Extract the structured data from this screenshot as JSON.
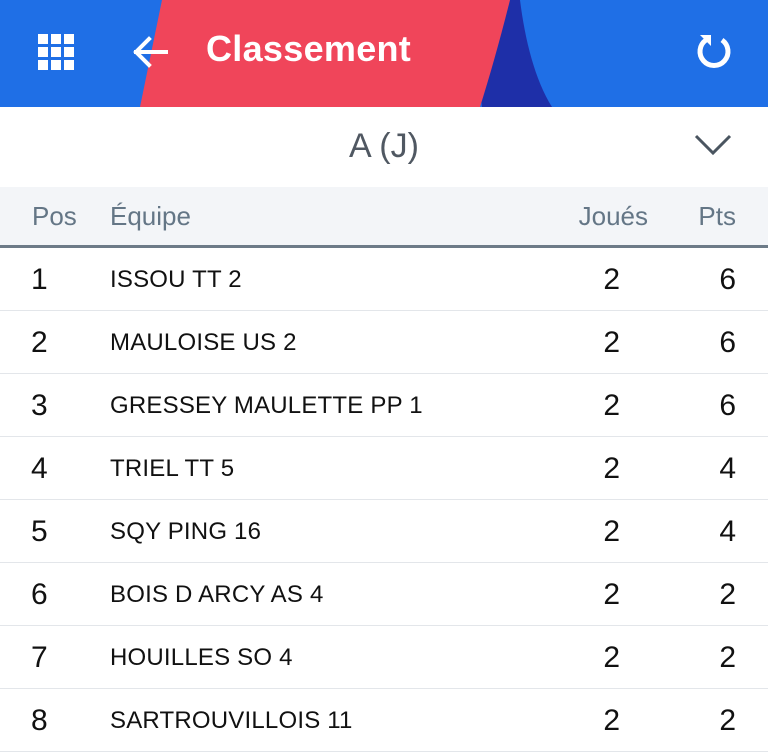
{
  "header": {
    "title": "Classement",
    "apps_icon": "grid-icon",
    "back_icon": "arrow-left-icon",
    "refresh_icon": "refresh-icon",
    "colors": {
      "blue": "#1f6fe6",
      "red": "#f0455a",
      "navy": "#1e2fa8"
    }
  },
  "group_selector": {
    "value": "A (J)",
    "icon": "chevron-down-icon"
  },
  "table": {
    "headers": {
      "pos": "Pos",
      "team": "Équipe",
      "played": "Joués",
      "points": "Pts"
    },
    "rows": [
      {
        "pos": "1",
        "team": "ISSOU TT 2",
        "played": "2",
        "points": "6"
      },
      {
        "pos": "2",
        "team": "MAULOISE US 2",
        "played": "2",
        "points": "6"
      },
      {
        "pos": "3",
        "team": "GRESSEY MAULETTE PP 1",
        "played": "2",
        "points": "6"
      },
      {
        "pos": "4",
        "team": "TRIEL TT 5",
        "played": "2",
        "points": "4"
      },
      {
        "pos": "5",
        "team": "SQY PING 16",
        "played": "2",
        "points": "4"
      },
      {
        "pos": "6",
        "team": "BOIS D ARCY AS 4",
        "played": "2",
        "points": "2"
      },
      {
        "pos": "7",
        "team": "HOUILLES SO 4",
        "played": "2",
        "points": "2"
      },
      {
        "pos": "8",
        "team": "SARTROUVILLOIS 11",
        "played": "2",
        "points": "2"
      }
    ]
  }
}
